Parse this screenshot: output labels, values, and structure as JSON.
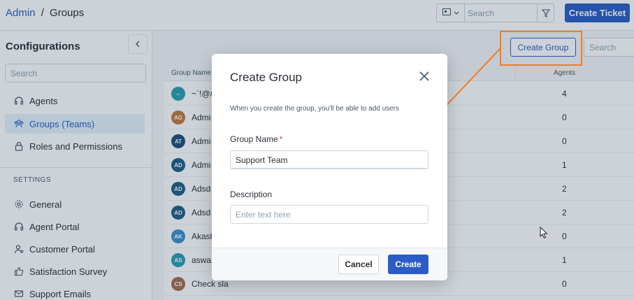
{
  "header": {
    "breadcrumb_root": "Admin",
    "breadcrumb_sep": "/",
    "breadcrumb_current": "Groups",
    "search_placeholder": "Search",
    "create_ticket_label": "Create Ticket"
  },
  "sidebar": {
    "title": "Configurations",
    "search_placeholder": "Search",
    "items": [
      {
        "label": "Agents",
        "icon": "headset-icon",
        "active": false
      },
      {
        "label": "Groups (Teams)",
        "icon": "team-icon",
        "active": true
      },
      {
        "label": "Roles and Permissions",
        "icon": "lock-icon",
        "active": false
      }
    ],
    "settings_label": "SETTINGS",
    "settings_items": [
      {
        "label": "General",
        "icon": "gear-icon"
      },
      {
        "label": "Agent Portal",
        "icon": "headset-icon"
      },
      {
        "label": "Customer Portal",
        "icon": "user-icon"
      },
      {
        "label": "Satisfaction Survey",
        "icon": "thumbs-up-icon"
      },
      {
        "label": "Support Emails",
        "icon": "mail-icon"
      }
    ]
  },
  "main": {
    "create_group_label": "Create Group",
    "search_placeholder": "Search",
    "columns": {
      "name": "Group Name",
      "agents": "Agents"
    },
    "rows": [
      {
        "initials": "--",
        "name": "~`!@#",
        "agents": "4",
        "color": "#2b9eb3"
      },
      {
        "initials": "AG",
        "name": "Admi",
        "agents": "0",
        "color": "#c47a3c"
      },
      {
        "initials": "AT",
        "name": "Admi",
        "agents": "0",
        "color": "#1f4d7a"
      },
      {
        "initials": "AD",
        "name": "Admi",
        "agents": "1",
        "color": "#1e5f86"
      },
      {
        "initials": "AD",
        "name": "Adsd",
        "agents": "2",
        "color": "#1e5f86"
      },
      {
        "initials": "AD",
        "name": "Adsd",
        "agents": "2",
        "color": "#1e5f86"
      },
      {
        "initials": "AK",
        "name": "Akash",
        "agents": "0",
        "color": "#3b8fd1"
      },
      {
        "initials": "AS",
        "name": "aswa",
        "agents": "1",
        "color": "#2b9eb3"
      },
      {
        "initials": "CS",
        "name": "Check sla",
        "agents": "0",
        "color": "#a86b4d"
      }
    ]
  },
  "modal": {
    "title": "Create Group",
    "description": "When you create the group, you'll be able to add users",
    "group_name_label": "Group Name",
    "required_mark": "*",
    "group_name_value": "Support Team",
    "description_label": "Description",
    "description_placeholder": "Enter text here",
    "cancel_label": "Cancel",
    "create_label": "Create"
  },
  "colors": {
    "accent": "#2c5cc5",
    "highlight": "#f57c23",
    "required": "#e43538"
  }
}
